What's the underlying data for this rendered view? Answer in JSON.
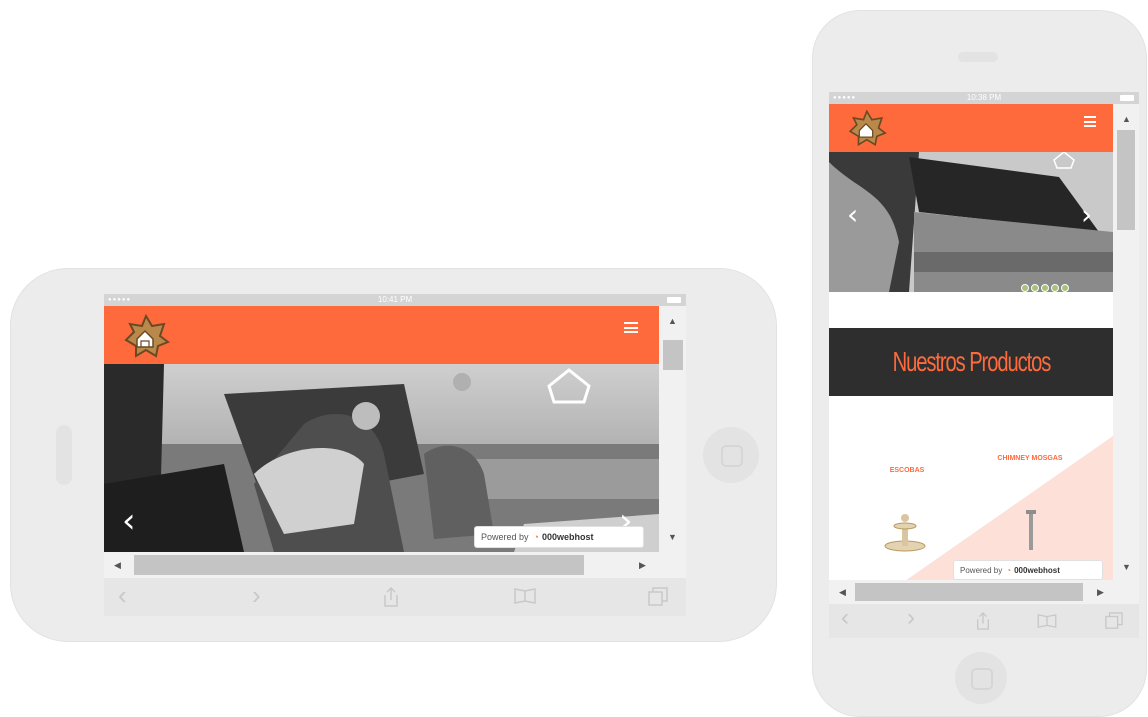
{
  "colors": {
    "brand_orange": "#ff6a3d",
    "banner_bg": "#2e2e2e",
    "device_body": "#ececec",
    "pink_band": "#fde0d8"
  },
  "landscape": {
    "status_time": "10:41 PM",
    "header": {
      "logo": "ranch-logo-icon",
      "menu_icon": "hamburger-menu-icon"
    },
    "slider": {
      "prev_arrow": "‹",
      "next_arrow": "›"
    },
    "powered": {
      "prefix": "Powered by",
      "brand": "000webhost"
    },
    "toolbar": {
      "back": "‹",
      "forward": "›"
    }
  },
  "portrait": {
    "status_time": "10:38 PM",
    "header": {
      "logo": "ranch-logo-icon",
      "menu_icon": "hamburger-menu-icon"
    },
    "slider": {
      "prev_arrow": "‹",
      "next_arrow": "›",
      "dots": 5
    },
    "section_title": "Nuestros Productos",
    "products": [
      {
        "name": "ESCOBAS"
      },
      {
        "name": "CHIMNEY MOSGAS"
      }
    ],
    "powered": {
      "prefix": "Powered by",
      "brand": "000webhost"
    },
    "toolbar": {
      "back": "‹",
      "forward": "›"
    }
  }
}
